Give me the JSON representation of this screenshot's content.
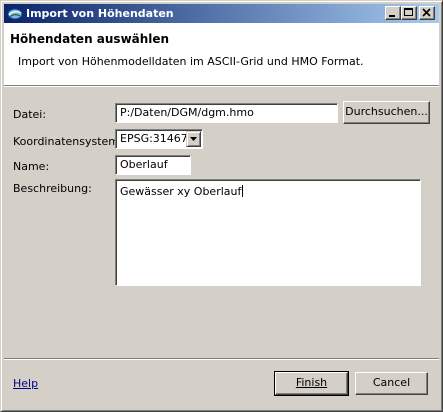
{
  "window": {
    "title": "Import von Höhendaten",
    "icon": "globe-app-icon",
    "controls": [
      "minimize",
      "maximize",
      "close"
    ]
  },
  "header": {
    "title": "Höhendaten auswählen",
    "description": "Import von Höhenmodelldaten im ASCII-Grid und HMO Format."
  },
  "form": {
    "file": {
      "label": "Datei:",
      "value": "P:/Daten/DGM/dgm.hmo",
      "browse_label": "Durchsuchen..."
    },
    "crs": {
      "label": "Koordinatensystem:",
      "value": "EPSG:31467"
    },
    "name": {
      "label": "Name:",
      "value": "Oberlauf"
    },
    "description": {
      "label": "Beschreibung:",
      "value": "Gewässer xy Oberlauf"
    }
  },
  "footer": {
    "help_label": "Help",
    "finish_label": "Finish",
    "cancel_label": "Cancel"
  },
  "colors": {
    "titlebar_start": "#0a246a",
    "titlebar_end": "#a6caf0",
    "dialog_bg": "#d4d0c8",
    "link": "#000080"
  }
}
